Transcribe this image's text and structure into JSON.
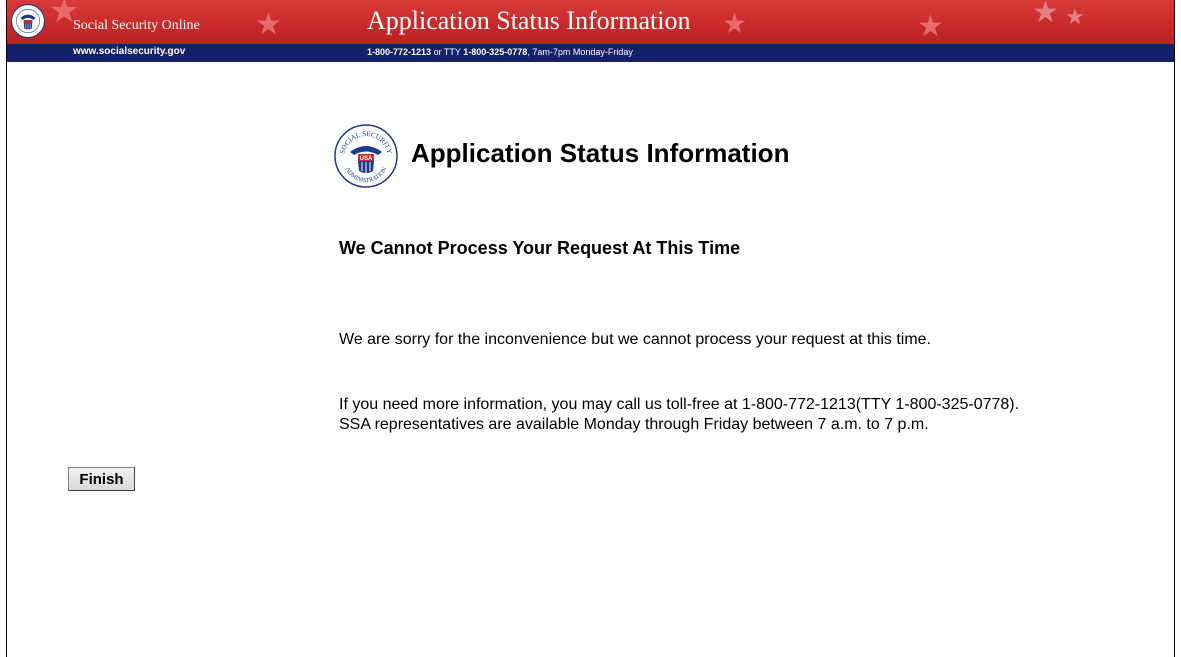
{
  "header": {
    "site_name": "Social Security Online",
    "title": "Application Status Information",
    "site_url": "www.socialsecurity.gov",
    "phone_primary": "1-800-772-1213",
    "phone_or": " or TTY ",
    "phone_tty": "1-800-325-0778",
    "phone_hours": ", 7am-7pm Monday-Friday"
  },
  "seal": {
    "top_text": "SOCIAL SECURITY",
    "bottom_text": "ADMINISTRATION",
    "usa": "USA"
  },
  "main": {
    "page_title": "Application Status Information",
    "subheading": "We Cannot Process Your Request At This Time",
    "paragraph1": "We are sorry for the inconvenience but we cannot process your request at this time.",
    "paragraph2": "If you need more information, you may call us toll-free at 1-800-772-1213(TTY 1-800-325-0778). SSA representatives are available Monday through Friday between 7 a.m. to 7 p.m."
  },
  "actions": {
    "finish_label": "Finish"
  },
  "colors": {
    "banner_red": "#c92a2a",
    "subbar_navy": "#14206a",
    "seal_blue": "#1c3a8a"
  }
}
